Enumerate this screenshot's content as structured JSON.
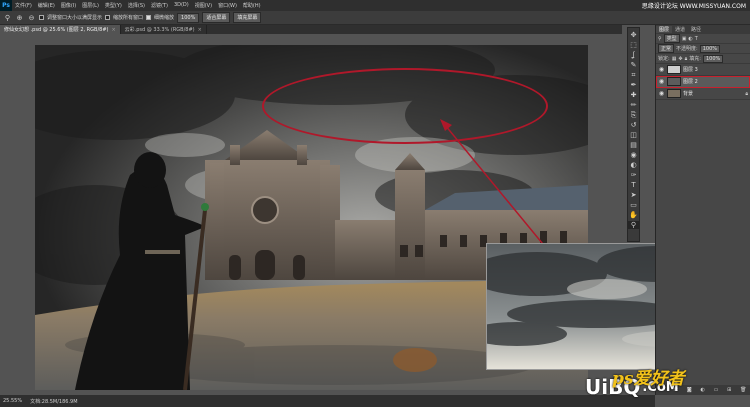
{
  "app": {
    "logo": "Ps",
    "menu": [
      "文件(F)",
      "编辑(E)",
      "图像(I)",
      "图层(L)",
      "类型(Y)",
      "选择(S)",
      "滤镜(T)",
      "3D(D)",
      "视图(V)",
      "窗口(W)",
      "帮助(H)"
    ],
    "watermark_top": "思缘设计论坛 WWW.MISSYUAN.COM"
  },
  "options": {
    "resize_windows_label": "调整窗口大小以满屏显示",
    "zoom_all_windows_label": "缩放所有窗口",
    "scrubby_zoom_label": "细微缩放",
    "zoom_value": "100%",
    "fit_screen_label": "适合屏幕",
    "fill_screen_label": "填充屏幕"
  },
  "tabs": [
    {
      "label": "修仙女幻想 .psd @ 25.6% (图层 2, RGB/8#)",
      "active": true
    },
    {
      "label": "云彩.psd @ 33.3% (RGB/8#)",
      "active": false
    }
  ],
  "tools": [
    "move-icon",
    "marquee-icon",
    "lasso-icon",
    "quick-select-icon",
    "crop-icon",
    "eyedropper-icon",
    "healing-icon",
    "brush-icon",
    "stamp-icon",
    "history-brush-icon",
    "eraser-icon",
    "gradient-icon",
    "blur-icon",
    "dodge-icon",
    "pen-icon",
    "type-icon",
    "path-select-icon",
    "shape-icon",
    "hand-icon",
    "zoom-icon"
  ],
  "tool_glyphs": [
    "✥",
    "⬚",
    "ʆ",
    "✎",
    "⌗",
    "✒",
    "✚",
    "✏",
    "⎘",
    "↺",
    "◫",
    "▤",
    "◉",
    "◐",
    "✑",
    "T",
    "➤",
    "▭",
    "✋",
    "⚲"
  ],
  "layers_panel": {
    "tabs": [
      "图层",
      "通道",
      "路径"
    ],
    "filter_label": "类型",
    "blend_mode": "正常",
    "opacity_label": "不透明度:",
    "opacity_value": "100%",
    "lock_label": "锁定:",
    "fill_label": "填充:",
    "fill_value": "100%",
    "layers": [
      {
        "name": "图层 3",
        "selected": false,
        "outlined": false,
        "thumb": "#cfcfcf"
      },
      {
        "name": "图层 2",
        "selected": true,
        "outlined": true,
        "thumb": "#5c5c5c"
      },
      {
        "name": "背景",
        "selected": false,
        "outlined": false,
        "thumb": "#7a6f60"
      }
    ]
  },
  "status": {
    "zoom": "25.55%",
    "doc_size": "文档:28.5M/186.9M"
  },
  "watermark_bottom": {
    "brand": "UiBQ",
    "suffix": ".CoM",
    "overlay": "ps爱好者"
  },
  "colors": {
    "annotation": "#b0182a",
    "layer_highlight": "#c8202d",
    "brand_blue": "#31a8ff"
  }
}
